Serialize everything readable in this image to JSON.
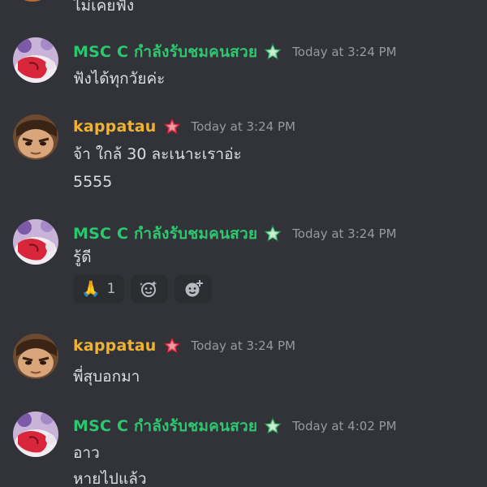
{
  "colors": {
    "background": "#313338",
    "msc_name": "#2dc770",
    "kappatau_name": "#f0b232",
    "timestamp": "#949ba4",
    "text": "#dbdee1"
  },
  "messages": [
    {
      "type": "continuation",
      "lines": [
        "ไม่เคยฟัง"
      ]
    },
    {
      "author": "MSC C  กำลังรับชมคนสวย",
      "badge_icon": "green-star-badge-icon",
      "timestamp": "Today at 3:24 PM",
      "lines": [
        "ฟังได้ทุกวัยค่ะ"
      ]
    },
    {
      "author": "kappatau",
      "badge_icon": "red-star-badge-icon",
      "timestamp": "Today at 3:24 PM",
      "lines": [
        "จ้า ใกล้ 30 ละเนาะเราอ่ะ",
        "5555"
      ]
    },
    {
      "author": "MSC C  กำลังรับชมคนสวย",
      "badge_icon": "green-star-badge-icon",
      "timestamp": "Today at 3:24 PM",
      "lines": [
        "รู้ดี"
      ],
      "reactions": [
        {
          "emoji": "🙏",
          "count": "1",
          "icon": "folded-hands-emoji"
        },
        {
          "icon": "add-super-reaction-icon"
        },
        {
          "icon": "add-reaction-icon"
        }
      ]
    },
    {
      "author": "kappatau",
      "badge_icon": "red-star-badge-icon",
      "timestamp": "Today at 3:24 PM",
      "lines": [
        "พี่สุบอกมา"
      ]
    },
    {
      "author": "MSC C  กำลังรับชมคนสวย",
      "badge_icon": "green-star-badge-icon",
      "timestamp": "Today at 4:02 PM",
      "lines": [
        "อาว",
        "หายไปแล้ว"
      ]
    }
  ]
}
